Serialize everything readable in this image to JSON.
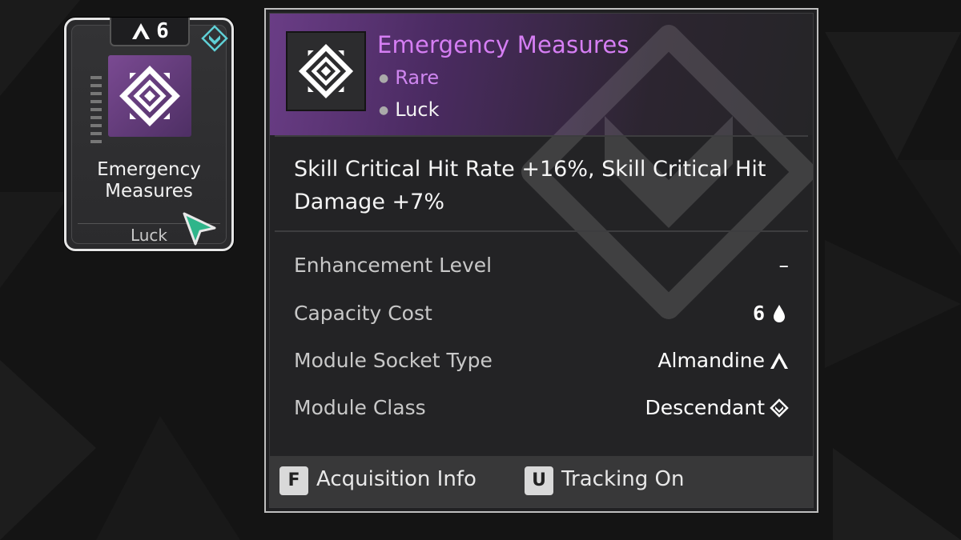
{
  "card": {
    "cost": "6",
    "name": "Emergency Measures",
    "category": "Luck"
  },
  "tooltip": {
    "title": "Emergency Measures",
    "rarity": "Rare",
    "category": "Luck",
    "effect": "Skill Critical Hit Rate +16%, Skill Critical Hit Damage +7%",
    "stats": [
      {
        "label": "Enhancement Level",
        "value": "–"
      },
      {
        "label": "Capacity Cost",
        "value": "6",
        "icon": "drop-icon"
      },
      {
        "label": "Module Socket Type",
        "value": "Almandine",
        "icon": "almandine-socket-icon"
      },
      {
        "label": "Module Class",
        "value": "Descendant",
        "icon": "descendant-class-icon"
      }
    ],
    "footer": [
      {
        "key": "F",
        "label": "Acquisition Info"
      },
      {
        "key": "U",
        "label": "Tracking On"
      }
    ]
  },
  "colors": {
    "rarity_purple": "#d67ef4",
    "art_purple": "#7a4a92",
    "badge_teal": "#5fd0d6",
    "cursor_green": "#2fb58a"
  }
}
